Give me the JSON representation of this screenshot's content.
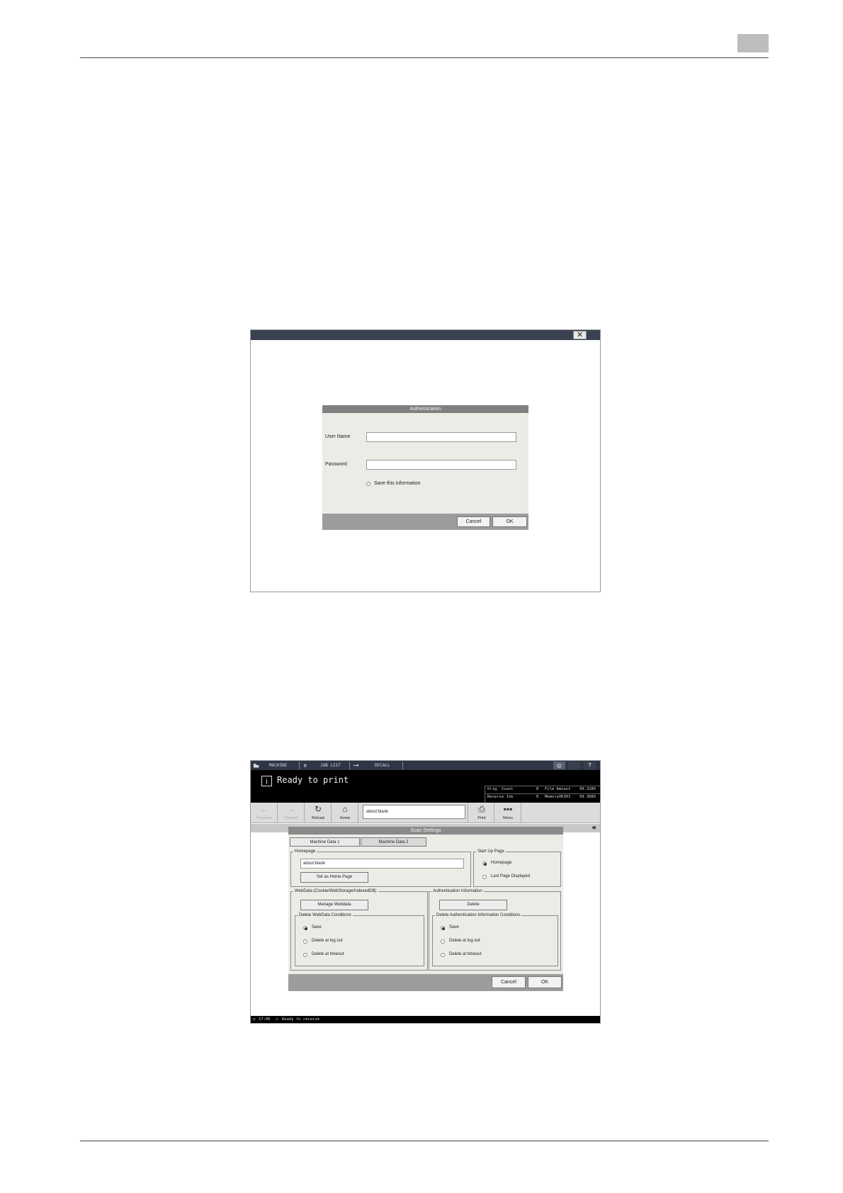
{
  "auth_screen": {
    "close_glyph": "✕",
    "dialog_title": "Authentication",
    "user_name_label": "User Name",
    "user_name_value": "",
    "password_label": "Password",
    "password_value": "",
    "save_info_label": "Save this information",
    "cancel_label": "Cancel",
    "ok_label": "OK"
  },
  "scan_screen": {
    "topbar": {
      "machine": "MACHINE",
      "job_list": "JOB LIST",
      "recall": "RECALL",
      "help": "?"
    },
    "status": {
      "message": "Ready to print",
      "orig_count_label": "Orig. Count",
      "orig_count_value": "0",
      "reserve_job_label": "Reserve Job",
      "reserve_job_value": "0",
      "file_amount_label": "File Amount",
      "file_amount_value": "99.328%",
      "memory_label": "MemoryUK301",
      "memory_value": "99.308%"
    },
    "toolbar": {
      "previous": "Previous",
      "forward": "Forward",
      "reload": "Reload",
      "home": "Home",
      "url": "about:blank",
      "print": "Print",
      "menu": "Menu"
    },
    "dialog": {
      "title": "Scan Settings",
      "tab1": "Machine Data 1",
      "tab2": "Machine Data 2",
      "homepage_group": "Homepage",
      "homepage_value": "about:blank",
      "set_home_button": "Set as Home Page",
      "startup_group": "Start Up Page",
      "startup_opt1": "Homepage",
      "startup_opt2": "Last Page Displayed",
      "webdata_group": "WebData (Cookie/WebStorage/IndexedDB)",
      "manage_webdata_button": "Manage Webdata",
      "delete_webdata_group": "Delete WebData Conditions",
      "webdata_opt1": "Save",
      "webdata_opt2": "Delete at log out",
      "webdata_opt3": "Delete at timeout",
      "auth_info_group": "Authentication Information",
      "delete_button": "Delete",
      "delete_auth_group": "Delete Authentication Information Conditions",
      "auth_opt1": "Save",
      "auth_opt2": "Delete at log out",
      "auth_opt3": "Delete at timeout",
      "cancel_label": "Cancel",
      "ok_label": "OK"
    },
    "bottombar": {
      "time": "17:06",
      "status": "Ready to receive"
    }
  }
}
